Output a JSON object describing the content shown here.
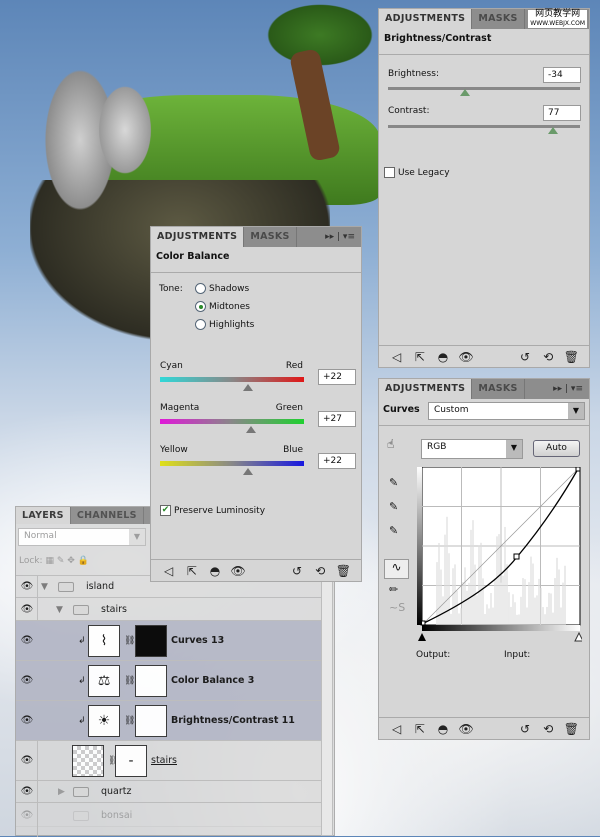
{
  "watermark": {
    "text": "网页教学网",
    "url_text": "WWW.WEBJX.COM"
  },
  "brightness_panel": {
    "tabs": [
      "ADJUSTMENTS",
      "MASKS"
    ],
    "title": "Brightness/Contrast",
    "brightness_label": "Brightness:",
    "brightness_value": "-34",
    "brightness_fraction": 0.4,
    "contrast_label": "Contrast:",
    "contrast_value": "77",
    "contrast_fraction": 0.86,
    "use_legacy_label": "Use Legacy",
    "use_legacy_checked": false
  },
  "color_balance_panel": {
    "tabs": [
      "ADJUSTMENTS",
      "MASKS"
    ],
    "title": "Color Balance",
    "tone_label": "Tone:",
    "tones": [
      "Shadows",
      "Midtones",
      "Highlights"
    ],
    "selected_tone": "Midtones",
    "sliders": [
      {
        "left": "Cyan",
        "right": "Red",
        "value": "+22",
        "colors": [
          "#30d8d8",
          "#e01818"
        ]
      },
      {
        "left": "Magenta",
        "right": "Green",
        "value": "+27",
        "colors": [
          "#e018d8",
          "#20d030"
        ]
      },
      {
        "left": "Yellow",
        "right": "Blue",
        "value": "+22",
        "colors": [
          "#e0e018",
          "#1818e0"
        ]
      }
    ],
    "preserve_luminosity_label": "Preserve Luminosity",
    "preserve_luminosity_checked": true
  },
  "curves_panel": {
    "tabs": [
      "ADJUSTMENTS",
      "MASKS"
    ],
    "title": "Curves",
    "preset": "Custom",
    "channel": "RGB",
    "auto_label": "Auto",
    "output_label": "Output:",
    "input_label": "Input:"
  },
  "layers_panel": {
    "tabs": [
      "LAYERS",
      "CHANNELS",
      "PA"
    ],
    "blend_mode": "Normal",
    "lock_label": "Lock:",
    "layers": [
      {
        "name": "island",
        "type": "group"
      },
      {
        "name": "stairs",
        "type": "group"
      },
      {
        "name": "Curves 13",
        "type": "adjustment"
      },
      {
        "name": "Color Balance 3",
        "type": "adjustment"
      },
      {
        "name": "Brightness/Contrast 11",
        "type": "adjustment"
      },
      {
        "name": "stairs",
        "type": "smart"
      },
      {
        "name": "quartz",
        "type": "group"
      },
      {
        "name": "bonsai",
        "type": "group"
      }
    ]
  }
}
